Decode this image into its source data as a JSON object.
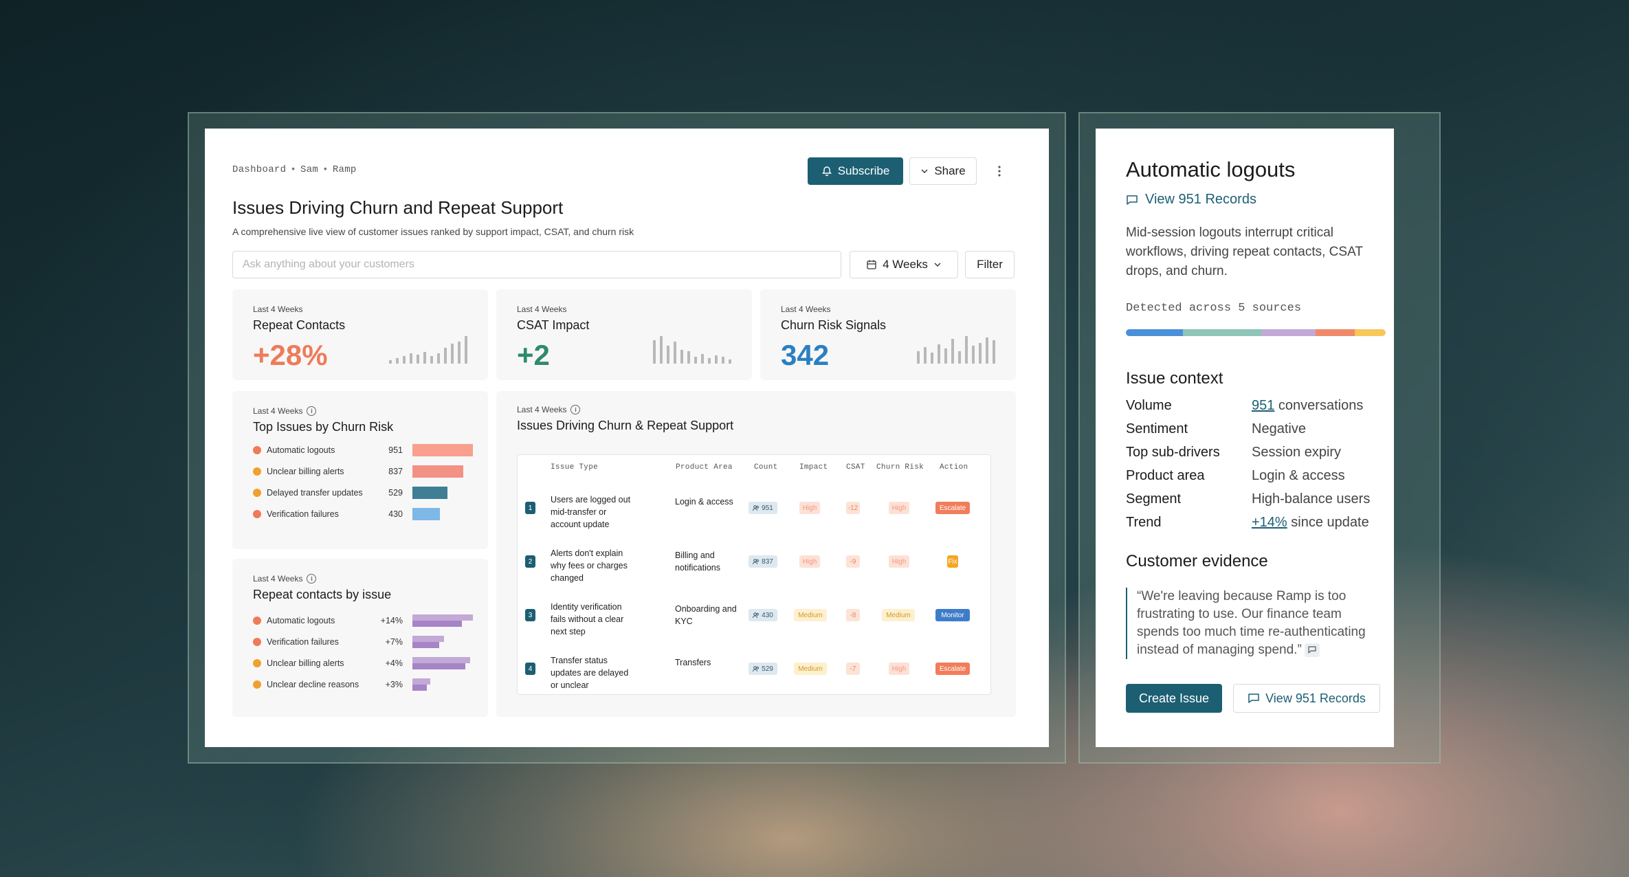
{
  "dashboard": {
    "breadcrumb": [
      "Dashboard",
      "Sam",
      "Ramp"
    ],
    "subscribe_label": "Subscribe",
    "share_label": "Share",
    "title": "Issues Driving Churn and Repeat Support",
    "description": "A comprehensive live view of customer issues ranked by support impact, CSAT, and churn risk",
    "search_placeholder": "Ask anything about your customers",
    "period_label": "4 Weeks",
    "filter_label": "Filter"
  },
  "stats": [
    {
      "period": "Last 4 Weeks",
      "title": "Repeat Contacts",
      "value": "+28%",
      "color": "#ee7b5a",
      "bars": [
        5,
        8,
        10,
        14,
        12,
        16,
        10,
        14,
        22,
        28,
        30,
        38
      ]
    },
    {
      "period": "Last 4 Weeks",
      "title": "CSAT Impact",
      "value": "+2",
      "color": "#2e8b6d",
      "bars": [
        34,
        40,
        26,
        32,
        20,
        18,
        10,
        14,
        8,
        12,
        10,
        6
      ]
    },
    {
      "period": "Last 4 Weeks",
      "title": "Churn Risk Signals",
      "value": "342",
      "color": "#2a7fc2",
      "bars": [
        18,
        24,
        16,
        28,
        22,
        36,
        18,
        40,
        26,
        30,
        38,
        34
      ]
    }
  ],
  "top_issues": {
    "period": "Last 4 Weeks",
    "title": "Top Issues by Churn Risk",
    "items": [
      {
        "label": "Automatic logouts",
        "value": "951",
        "share": 1.0,
        "dot": "#ee7b5a",
        "bar": "#f8a08d"
      },
      {
        "label": "Unclear billing alerts",
        "value": "837",
        "share": 0.84,
        "dot": "#f0a030",
        "bar": "#f49185"
      },
      {
        "label": "Delayed transfer updates",
        "value": "529",
        "share": 0.58,
        "dot": "#f0a030",
        "bar": "#3f7e94"
      },
      {
        "label": "Verification failures",
        "value": "430",
        "share": 0.46,
        "dot": "#ee7b5a",
        "bar": "#7db8e6"
      }
    ]
  },
  "repeat_contacts": {
    "period": "Last 4 Weeks",
    "title": "Repeat contacts by issue",
    "items": [
      {
        "label": "Automatic logouts",
        "value": "+14%",
        "dot": "#ee7b5a",
        "top": 1.0,
        "bottom": 0.82
      },
      {
        "label": "Verification failures",
        "value": "+7%",
        "dot": "#ee7b5a",
        "top": 0.52,
        "bottom": 0.44
      },
      {
        "label": "Unclear billing alerts",
        "value": "+4%",
        "dot": "#f0a030",
        "top": 0.95,
        "bottom": 0.88
      },
      {
        "label": "Unclear decline reasons",
        "value": "+3%",
        "dot": "#f0a030",
        "top": 0.3,
        "bottom": 0.24
      }
    ]
  },
  "issues_table": {
    "period": "Last 4 Weeks",
    "title": "Issues Driving Churn & Repeat Support",
    "columns": [
      "Issue Type",
      "Product Area",
      "Count",
      "Impact",
      "CSAT",
      "Churn Risk",
      "Action"
    ],
    "rows": [
      {
        "num": "1",
        "issue": "Users are logged out mid-transfer or account update",
        "area": "Login & access",
        "count": "951",
        "impact": "High",
        "csat": "-12",
        "risk": "High",
        "action": "Escalate",
        "action_color": "#f27d5a"
      },
      {
        "num": "2",
        "issue": "Alerts don't explain why fees or charges changed",
        "area": "Billing and notifications",
        "count": "837",
        "impact": "High",
        "csat": "-9",
        "risk": "High",
        "action": "Fix",
        "action_color": "#f5a623"
      },
      {
        "num": "3",
        "issue": "Identity verification fails without a clear next step",
        "area": "Onboarding and KYC",
        "count": "430",
        "impact": "Medium",
        "csat": "-8",
        "risk": "Medium",
        "action": "Monitor",
        "action_color": "#3d7cc9"
      },
      {
        "num": "4",
        "issue": "Transfer status updates are delayed or unclear",
        "area": "Transfers",
        "count": "529",
        "impact": "Medium",
        "csat": "-7",
        "risk": "High",
        "action": "Escalate",
        "action_color": "#f27d5a"
      }
    ]
  },
  "detail": {
    "title": "Automatic logouts",
    "records_link": "View 951 Records",
    "description": "Mid-session logouts interrupt critical workflows, driving repeat contacts, CSAT drops, and churn.",
    "detected": "Detected across 5 sources",
    "sources": [
      {
        "color": "#4a90d9",
        "share": 0.22
      },
      {
        "color": "#8fc4b8",
        "share": 0.3
      },
      {
        "color": "#c3a9d6",
        "share": 0.21
      },
      {
        "color": "#f08a6a",
        "share": 0.15
      },
      {
        "color": "#f7c75a",
        "share": 0.12
      }
    ],
    "context_title": "Issue context",
    "context": [
      {
        "key": "Volume",
        "value_link": "951",
        "value": " conversations"
      },
      {
        "key": "Sentiment",
        "value_link": "",
        "value": "Negative"
      },
      {
        "key": "Top sub-drivers",
        "value_link": "",
        "value": "Session expiry"
      },
      {
        "key": "Product area",
        "value_link": "",
        "value": "Login & access"
      },
      {
        "key": "Segment",
        "value_link": "",
        "value": "High-balance users"
      },
      {
        "key": "Trend",
        "value_link": "+14%",
        "value": " since update"
      }
    ],
    "evidence_title": "Customer evidence",
    "quote": "“We're leaving because Ramp is too frustrating to use. Our finance team spends too much time re-authenticating instead of managing spend.”",
    "create_label": "Create Issue",
    "records_button": "View 951 Records"
  },
  "colors": {
    "accent": "#1c5f73"
  }
}
